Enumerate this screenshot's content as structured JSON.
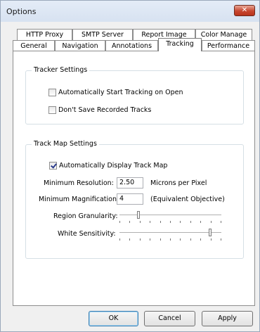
{
  "window": {
    "title": "Options",
    "close_glyph": "✕"
  },
  "tabs_row1": [
    {
      "label": "HTTP Proxy"
    },
    {
      "label": "SMTP Server"
    },
    {
      "label": "Report Image"
    },
    {
      "label": "Color Manage"
    }
  ],
  "tabs_row2": [
    {
      "label": "General"
    },
    {
      "label": "Navigation"
    },
    {
      "label": "Annotations"
    },
    {
      "label": "Tracking",
      "active": true
    },
    {
      "label": "Performance"
    }
  ],
  "tracker_settings": {
    "title": "Tracker Settings",
    "auto_start": {
      "label": "Automatically Start Tracking on Open",
      "checked": false
    },
    "dont_save": {
      "label": "Don't Save Recorded Tracks",
      "checked": false
    }
  },
  "track_map_settings": {
    "title": "Track Map Settings",
    "auto_display": {
      "label": "Automatically Display Track Map",
      "checked": true
    },
    "min_resolution": {
      "label": "Minimum Resolution:",
      "value": "2.50",
      "unit": "Microns per Pixel"
    },
    "min_magnification": {
      "label": "Minimum Magnification:",
      "value": "4",
      "unit": "(Equivalent Objective)"
    },
    "region_granularity": {
      "label": "Region Granularity:",
      "level": 0.18,
      "ticks": 11
    },
    "white_sensitivity": {
      "label": "White Sensitivity:",
      "level": 0.9,
      "ticks": 11
    }
  },
  "buttons": {
    "ok": "OK",
    "cancel": "Cancel",
    "apply": "Apply"
  }
}
